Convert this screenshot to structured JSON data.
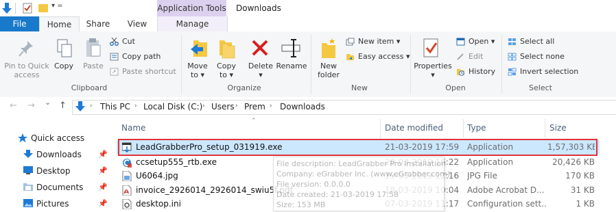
{
  "window": {
    "title": "Downloads",
    "context_tab_group": "Application Tools"
  },
  "quick_access_toolbar": {
    "icons": [
      "down-arrow-icon",
      "properties-icon",
      "new-folder-icon",
      "customize-dropdown-icon"
    ],
    "more_glyph": "▾ ="
  },
  "tabs": [
    {
      "label": "File"
    },
    {
      "label": "Home"
    },
    {
      "label": "Share"
    },
    {
      "label": "View"
    },
    {
      "label": "Manage"
    }
  ],
  "ribbon": {
    "clipboard": {
      "label": "Clipboard",
      "pin_to_quick_access": "Pin to Quick access",
      "pin_line1": "Pin to Quick",
      "pin_line2": "access",
      "copy": "Copy",
      "paste": "Paste",
      "cut": "Cut",
      "copy_path": "Copy path",
      "paste_shortcut": "Paste shortcut"
    },
    "organize": {
      "label": "Organize",
      "move_to_line1": "Move",
      "move_to_line2": "to ▾",
      "copy_to_line1": "Copy",
      "copy_to_line2": "to ▾",
      "delete_line1": "Delete",
      "delete_line2": "▾",
      "rename": "Rename"
    },
    "new": {
      "label": "New",
      "new_folder_line1": "New",
      "new_folder_line2": "folder",
      "new_item": "New item ▾",
      "easy_access": "Easy access ▾"
    },
    "open": {
      "label": "Open",
      "properties_line1": "Properties",
      "properties_line2": "▾",
      "open": "Open ▾",
      "edit": "Edit",
      "history": "History"
    },
    "select": {
      "label": "Select",
      "select_all": "Select all",
      "select_none": "Select none",
      "invert_selection": "Invert selection"
    }
  },
  "address_bar": {
    "back_glyph": "←",
    "forward_glyph": "→",
    "dropdown_glyph": "⌄",
    "up_glyph": "↑",
    "breadcrumbs": [
      "This PC",
      "Local Disk (C:)",
      "Users",
      "Prem",
      "Downloads"
    ],
    "separator": "›"
  },
  "nav_pane": {
    "items": [
      {
        "label": "Quick access",
        "icon": "star-icon"
      },
      {
        "label": "Downloads",
        "icon": "download-icon",
        "pinned": true
      },
      {
        "label": "Desktop",
        "icon": "desktop-icon",
        "pinned": true
      },
      {
        "label": "Documents",
        "icon": "documents-icon",
        "pinned": true
      },
      {
        "label": "Pictures",
        "icon": "pictures-icon",
        "pinned": true
      }
    ],
    "pin_glyph": "📌"
  },
  "file_list": {
    "columns": [
      "Name",
      "Date modified",
      "Type",
      "Size"
    ],
    "sort_glyph": "⌃",
    "rows": [
      {
        "name": "LeadGrabberPro_setup_031919.exe",
        "date": "21-03-2019 17:59",
        "type": "Application",
        "size": "1,57,303 KB",
        "icon": "installer-icon",
        "selected": true
      },
      {
        "name": "ccsetup555_rtb.exe",
        "date": "20-03-2019 16:22",
        "type": "Application",
        "size": "20,426 KB",
        "icon": "ccleaner-icon",
        "selected": false
      },
      {
        "name": "U6064.jpg",
        "date": "19-03-2019 12:16",
        "type": "JPG File",
        "size": "170 KB",
        "icon": "image-file-icon",
        "selected": false
      },
      {
        "name": "invoice_2926014_2926014_swiu5f.pdf",
        "date": "18-03-2019 10:04",
        "type": "Adobe Acrobat D...",
        "size": "31 KB",
        "icon": "pdf-icon",
        "selected": false
      },
      {
        "name": "desktop.ini",
        "date": "07-03-2019 11:17",
        "type": "Configuration sett...",
        "size": "1 KB",
        "icon": "settings-file-icon",
        "selected": false
      }
    ]
  },
  "tooltip": {
    "lines": [
      "File description: LeadGrabber Pro Installation",
      "Company: eGrabber Inc. (www.eGrabber.com)",
      "File version: 0.0.0.0",
      "Date created: 21-03-2019 17:58",
      "Size: 153 MB"
    ]
  },
  "colors": {
    "file_tab": "#1979ca",
    "context_tab": "#dcd0ef",
    "selection": "#cce8ff",
    "highlight_outline": "#e0313a",
    "folder": "#f5c842"
  }
}
